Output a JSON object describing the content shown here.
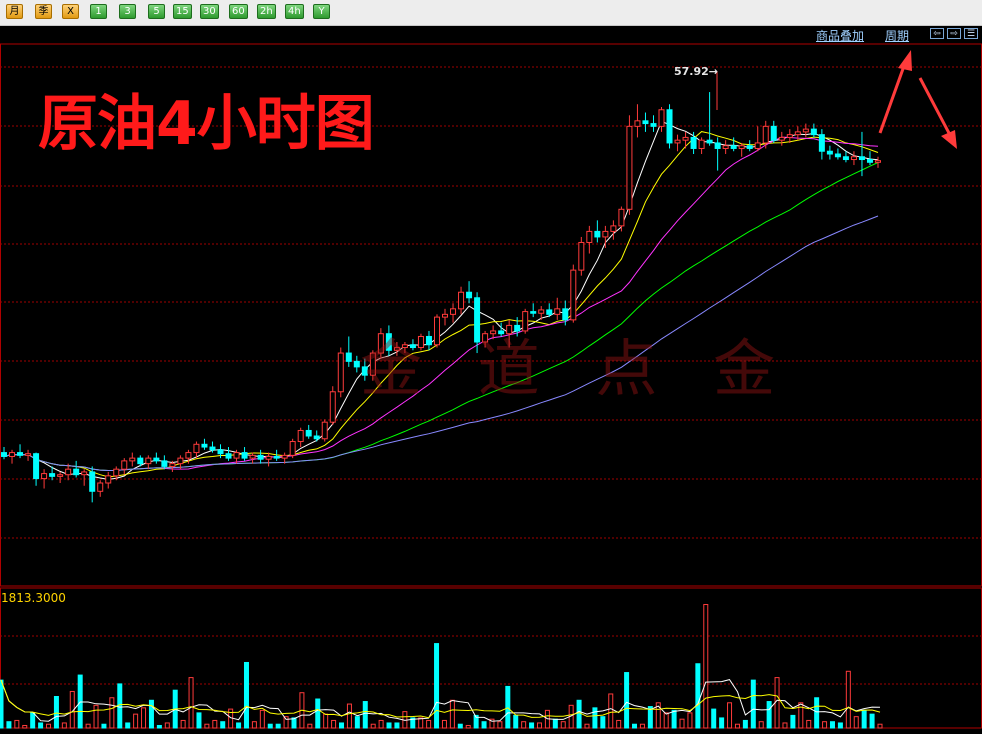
{
  "toolbar": {
    "buttons": [
      {
        "label": "月",
        "style": "orange"
      },
      {
        "label": "季",
        "style": "orange"
      },
      {
        "label": "X",
        "style": "orange"
      },
      {
        "label": "1",
        "style": "green"
      },
      {
        "label": "3",
        "style": "green"
      },
      {
        "label": "5",
        "style": "green"
      },
      {
        "label": "15",
        "style": "green"
      },
      {
        "label": "30",
        "style": "green"
      },
      {
        "label": "60",
        "style": "green"
      },
      {
        "label": "2h",
        "style": "green"
      },
      {
        "label": "4h",
        "style": "green"
      },
      {
        "label": "Y",
        "style": "green"
      }
    ]
  },
  "header": {
    "overlay_link": "商品叠加",
    "period_link": "周期",
    "nav_icons": [
      "arrow-left-icon",
      "arrow-right-icon",
      "panel-icon"
    ]
  },
  "title": "原油4小时图",
  "watermark": "金 道 点 金",
  "price_annotation": "57.92",
  "volume": {
    "max_label": "1813.3000"
  },
  "colors": {
    "up": "#ff3b3b",
    "down": "#00ffff",
    "ma5": "#ffffff",
    "ma10": "#ffff00",
    "ma20": "#ff33ff",
    "ma40": "#00ff00",
    "ma60": "#8888ff",
    "grid": "#a00000",
    "title": "#ff1a1a"
  },
  "chart_data": {
    "type": "candlestick",
    "candles": [
      {
        "o": 51.4,
        "h": 51.5,
        "l": 51.28,
        "c": 51.33
      },
      {
        "o": 51.33,
        "h": 51.45,
        "l": 51.2,
        "c": 51.4
      },
      {
        "o": 51.4,
        "h": 51.55,
        "l": 51.3,
        "c": 51.35
      },
      {
        "o": 51.35,
        "h": 51.45,
        "l": 51.25,
        "c": 51.38
      },
      {
        "o": 51.38,
        "h": 51.4,
        "l": 50.8,
        "c": 50.93
      },
      {
        "o": 50.93,
        "h": 51.1,
        "l": 50.75,
        "c": 51.02
      },
      {
        "o": 51.02,
        "h": 51.15,
        "l": 50.9,
        "c": 50.97
      },
      {
        "o": 50.97,
        "h": 51.05,
        "l": 50.85,
        "c": 51.0
      },
      {
        "o": 51.0,
        "h": 51.2,
        "l": 50.9,
        "c": 51.1
      },
      {
        "o": 51.1,
        "h": 51.25,
        "l": 50.95,
        "c": 51.0
      },
      {
        "o": 51.0,
        "h": 51.1,
        "l": 50.8,
        "c": 51.05
      },
      {
        "o": 51.05,
        "h": 51.15,
        "l": 50.5,
        "c": 50.7
      },
      {
        "o": 50.7,
        "h": 50.9,
        "l": 50.6,
        "c": 50.85
      },
      {
        "o": 50.85,
        "h": 51.05,
        "l": 50.75,
        "c": 50.98
      },
      {
        "o": 50.98,
        "h": 51.15,
        "l": 50.9,
        "c": 51.1
      },
      {
        "o": 51.1,
        "h": 51.3,
        "l": 51.0,
        "c": 51.25
      },
      {
        "o": 51.25,
        "h": 51.4,
        "l": 51.15,
        "c": 51.3
      },
      {
        "o": 51.3,
        "h": 51.35,
        "l": 51.15,
        "c": 51.2
      },
      {
        "o": 51.2,
        "h": 51.35,
        "l": 51.1,
        "c": 51.3
      },
      {
        "o": 51.3,
        "h": 51.4,
        "l": 51.2,
        "c": 51.25
      },
      {
        "o": 51.25,
        "h": 51.35,
        "l": 51.1,
        "c": 51.15
      },
      {
        "o": 51.15,
        "h": 51.25,
        "l": 51.05,
        "c": 51.2
      },
      {
        "o": 51.2,
        "h": 51.35,
        "l": 51.1,
        "c": 51.3
      },
      {
        "o": 51.3,
        "h": 51.45,
        "l": 51.2,
        "c": 51.4
      },
      {
        "o": 51.4,
        "h": 51.6,
        "l": 51.3,
        "c": 51.55
      },
      {
        "o": 51.55,
        "h": 51.65,
        "l": 51.45,
        "c": 51.5
      },
      {
        "o": 51.5,
        "h": 51.6,
        "l": 51.4,
        "c": 51.45
      },
      {
        "o": 51.45,
        "h": 51.55,
        "l": 51.3,
        "c": 51.38
      },
      {
        "o": 51.38,
        "h": 51.5,
        "l": 51.25,
        "c": 51.3
      },
      {
        "o": 51.3,
        "h": 51.45,
        "l": 51.2,
        "c": 51.4
      },
      {
        "o": 51.4,
        "h": 51.5,
        "l": 51.25,
        "c": 51.3
      },
      {
        "o": 51.3,
        "h": 51.4,
        "l": 51.2,
        "c": 51.35
      },
      {
        "o": 51.35,
        "h": 51.45,
        "l": 51.2,
        "c": 51.28
      },
      {
        "o": 51.28,
        "h": 51.4,
        "l": 51.15,
        "c": 51.33
      },
      {
        "o": 51.33,
        "h": 51.45,
        "l": 51.25,
        "c": 51.3
      },
      {
        "o": 51.3,
        "h": 51.4,
        "l": 51.2,
        "c": 51.35
      },
      {
        "o": 51.35,
        "h": 51.65,
        "l": 51.3,
        "c": 51.6
      },
      {
        "o": 51.6,
        "h": 51.85,
        "l": 51.5,
        "c": 51.8
      },
      {
        "o": 51.8,
        "h": 51.9,
        "l": 51.65,
        "c": 51.7
      },
      {
        "o": 51.7,
        "h": 51.8,
        "l": 51.6,
        "c": 51.65
      },
      {
        "o": 51.65,
        "h": 52.0,
        "l": 51.6,
        "c": 51.95
      },
      {
        "o": 51.95,
        "h": 52.6,
        "l": 51.9,
        "c": 52.5
      },
      {
        "o": 52.5,
        "h": 53.3,
        "l": 52.4,
        "c": 53.2
      },
      {
        "o": 53.2,
        "h": 53.5,
        "l": 52.95,
        "c": 53.05
      },
      {
        "o": 53.05,
        "h": 53.15,
        "l": 52.85,
        "c": 52.95
      },
      {
        "o": 52.95,
        "h": 53.1,
        "l": 52.7,
        "c": 52.8
      },
      {
        "o": 52.8,
        "h": 53.25,
        "l": 52.7,
        "c": 53.2
      },
      {
        "o": 53.2,
        "h": 53.65,
        "l": 53.1,
        "c": 53.55
      },
      {
        "o": 53.55,
        "h": 53.7,
        "l": 53.15,
        "c": 53.25
      },
      {
        "o": 53.25,
        "h": 53.4,
        "l": 53.15,
        "c": 53.3
      },
      {
        "o": 53.3,
        "h": 53.4,
        "l": 53.2,
        "c": 53.35
      },
      {
        "o": 53.35,
        "h": 53.45,
        "l": 53.25,
        "c": 53.3
      },
      {
        "o": 53.3,
        "h": 53.55,
        "l": 53.25,
        "c": 53.5
      },
      {
        "o": 53.5,
        "h": 53.6,
        "l": 53.25,
        "c": 53.35
      },
      {
        "o": 53.35,
        "h": 53.9,
        "l": 53.3,
        "c": 53.85
      },
      {
        "o": 53.85,
        "h": 54.0,
        "l": 53.7,
        "c": 53.9
      },
      {
        "o": 53.9,
        "h": 54.1,
        "l": 53.75,
        "c": 54.0
      },
      {
        "o": 54.0,
        "h": 54.4,
        "l": 53.9,
        "c": 54.3
      },
      {
        "o": 54.3,
        "h": 54.5,
        "l": 54.1,
        "c": 54.2
      },
      {
        "o": 54.2,
        "h": 54.3,
        "l": 53.2,
        "c": 53.4
      },
      {
        "o": 53.4,
        "h": 53.6,
        "l": 53.3,
        "c": 53.55
      },
      {
        "o": 53.55,
        "h": 53.7,
        "l": 53.45,
        "c": 53.6
      },
      {
        "o": 53.6,
        "h": 53.75,
        "l": 53.5,
        "c": 53.55
      },
      {
        "o": 53.55,
        "h": 53.8,
        "l": 53.3,
        "c": 53.7
      },
      {
        "o": 53.7,
        "h": 53.85,
        "l": 53.5,
        "c": 53.6
      },
      {
        "o": 53.6,
        "h": 54.0,
        "l": 53.55,
        "c": 53.95
      },
      {
        "o": 53.95,
        "h": 54.1,
        "l": 53.85,
        "c": 53.92
      },
      {
        "o": 53.92,
        "h": 54.05,
        "l": 53.8,
        "c": 53.98
      },
      {
        "o": 53.98,
        "h": 54.1,
        "l": 53.85,
        "c": 53.9
      },
      {
        "o": 53.9,
        "h": 54.2,
        "l": 53.8,
        "c": 54.0
      },
      {
        "o": 54.0,
        "h": 54.15,
        "l": 53.7,
        "c": 53.8
      },
      {
        "o": 53.8,
        "h": 54.8,
        "l": 53.75,
        "c": 54.7
      },
      {
        "o": 54.7,
        "h": 55.3,
        "l": 54.6,
        "c": 55.2
      },
      {
        "o": 55.2,
        "h": 55.5,
        "l": 55.0,
        "c": 55.4
      },
      {
        "o": 55.4,
        "h": 55.6,
        "l": 55.2,
        "c": 55.3
      },
      {
        "o": 55.3,
        "h": 55.5,
        "l": 55.1,
        "c": 55.4
      },
      {
        "o": 55.4,
        "h": 55.6,
        "l": 55.25,
        "c": 55.5
      },
      {
        "o": 55.5,
        "h": 55.85,
        "l": 55.4,
        "c": 55.8
      },
      {
        "o": 55.8,
        "h": 57.5,
        "l": 55.7,
        "c": 57.3
      },
      {
        "o": 57.3,
        "h": 57.7,
        "l": 57.1,
        "c": 57.4
      },
      {
        "o": 57.4,
        "h": 57.55,
        "l": 57.2,
        "c": 57.35
      },
      {
        "o": 57.35,
        "h": 57.5,
        "l": 57.2,
        "c": 57.3
      },
      {
        "o": 57.3,
        "h": 57.65,
        "l": 57.2,
        "c": 57.6
      },
      {
        "o": 57.6,
        "h": 57.7,
        "l": 56.9,
        "c": 57.0
      },
      {
        "o": 57.0,
        "h": 57.15,
        "l": 56.85,
        "c": 57.05
      },
      {
        "o": 57.05,
        "h": 57.2,
        "l": 56.9,
        "c": 57.1
      },
      {
        "o": 57.1,
        "h": 57.2,
        "l": 56.8,
        "c": 56.9
      },
      {
        "o": 56.9,
        "h": 57.1,
        "l": 56.8,
        "c": 57.05
      },
      {
        "o": 57.05,
        "h": 57.92,
        "l": 56.95,
        "c": 57.0
      },
      {
        "o": 57.0,
        "h": 57.1,
        "l": 56.5,
        "c": 56.9
      },
      {
        "o": 56.9,
        "h": 57.05,
        "l": 56.8,
        "c": 56.95
      },
      {
        "o": 56.95,
        "h": 57.1,
        "l": 56.85,
        "c": 56.9
      },
      {
        "o": 56.9,
        "h": 57.0,
        "l": 56.75,
        "c": 56.95
      },
      {
        "o": 56.95,
        "h": 57.05,
        "l": 56.85,
        "c": 56.9
      },
      {
        "o": 56.9,
        "h": 57.3,
        "l": 56.85,
        "c": 57.0
      },
      {
        "o": 57.0,
        "h": 57.4,
        "l": 56.9,
        "c": 57.3
      },
      {
        "o": 57.3,
        "h": 57.4,
        "l": 57.0,
        "c": 57.05
      },
      {
        "o": 57.05,
        "h": 57.2,
        "l": 56.95,
        "c": 57.1
      },
      {
        "o": 57.1,
        "h": 57.25,
        "l": 57.0,
        "c": 57.15
      },
      {
        "o": 57.15,
        "h": 57.3,
        "l": 57.05,
        "c": 57.2
      },
      {
        "o": 57.2,
        "h": 57.35,
        "l": 57.1,
        "c": 57.25
      },
      {
        "o": 57.25,
        "h": 57.35,
        "l": 57.1,
        "c": 57.15
      },
      {
        "o": 57.15,
        "h": 57.25,
        "l": 56.7,
        "c": 56.85
      },
      {
        "o": 56.85,
        "h": 56.95,
        "l": 56.7,
        "c": 56.8
      },
      {
        "o": 56.8,
        "h": 56.9,
        "l": 56.7,
        "c": 56.75
      },
      {
        "o": 56.75,
        "h": 56.85,
        "l": 56.65,
        "c": 56.7
      },
      {
        "o": 56.7,
        "h": 56.85,
        "l": 56.6,
        "c": 56.75
      },
      {
        "o": 56.75,
        "h": 57.2,
        "l": 56.4,
        "c": 56.7
      },
      {
        "o": 56.7,
        "h": 56.85,
        "l": 56.6,
        "c": 56.65
      },
      {
        "o": 56.65,
        "h": 56.75,
        "l": 56.55,
        "c": 56.68
      }
    ],
    "moving_averages": [
      {
        "name": "MA5",
        "period": 5
      },
      {
        "name": "MA10",
        "period": 10
      },
      {
        "name": "MA20",
        "period": 20
      },
      {
        "name": "MA40",
        "period": 40
      },
      {
        "name": "MA60",
        "period": 60
      }
    ],
    "volume": [
      38,
      5,
      6,
      2,
      12,
      4,
      3,
      25,
      4,
      29,
      42,
      3,
      18,
      3,
      24,
      35,
      4,
      11,
      16,
      22,
      2,
      4,
      30,
      6,
      40,
      12,
      3,
      6,
      5,
      15,
      4,
      52,
      5,
      14,
      3,
      3,
      9,
      8,
      28,
      3,
      23,
      11,
      6,
      4,
      19,
      9,
      21,
      3,
      6,
      4,
      4,
      13,
      8,
      8,
      6,
      67,
      6,
      22,
      3,
      2,
      10,
      5,
      7,
      5,
      33,
      10,
      5,
      4,
      4,
      14,
      7,
      5,
      18,
      22,
      3,
      16,
      9,
      27,
      6,
      44,
      3,
      3,
      17,
      20,
      12,
      14,
      7,
      12,
      51,
      98,
      15,
      8,
      20,
      3,
      6,
      38,
      5,
      21,
      40,
      4,
      10,
      20,
      6,
      24,
      5,
      5,
      4,
      45,
      9,
      14,
      11,
      3
    ],
    "volume_axis_max": 1813.3,
    "y_range": [
      50.0,
      58.5
    ]
  },
  "annotations": {
    "arrows": [
      "arrow-up-icon",
      "arrow-down-icon"
    ]
  }
}
